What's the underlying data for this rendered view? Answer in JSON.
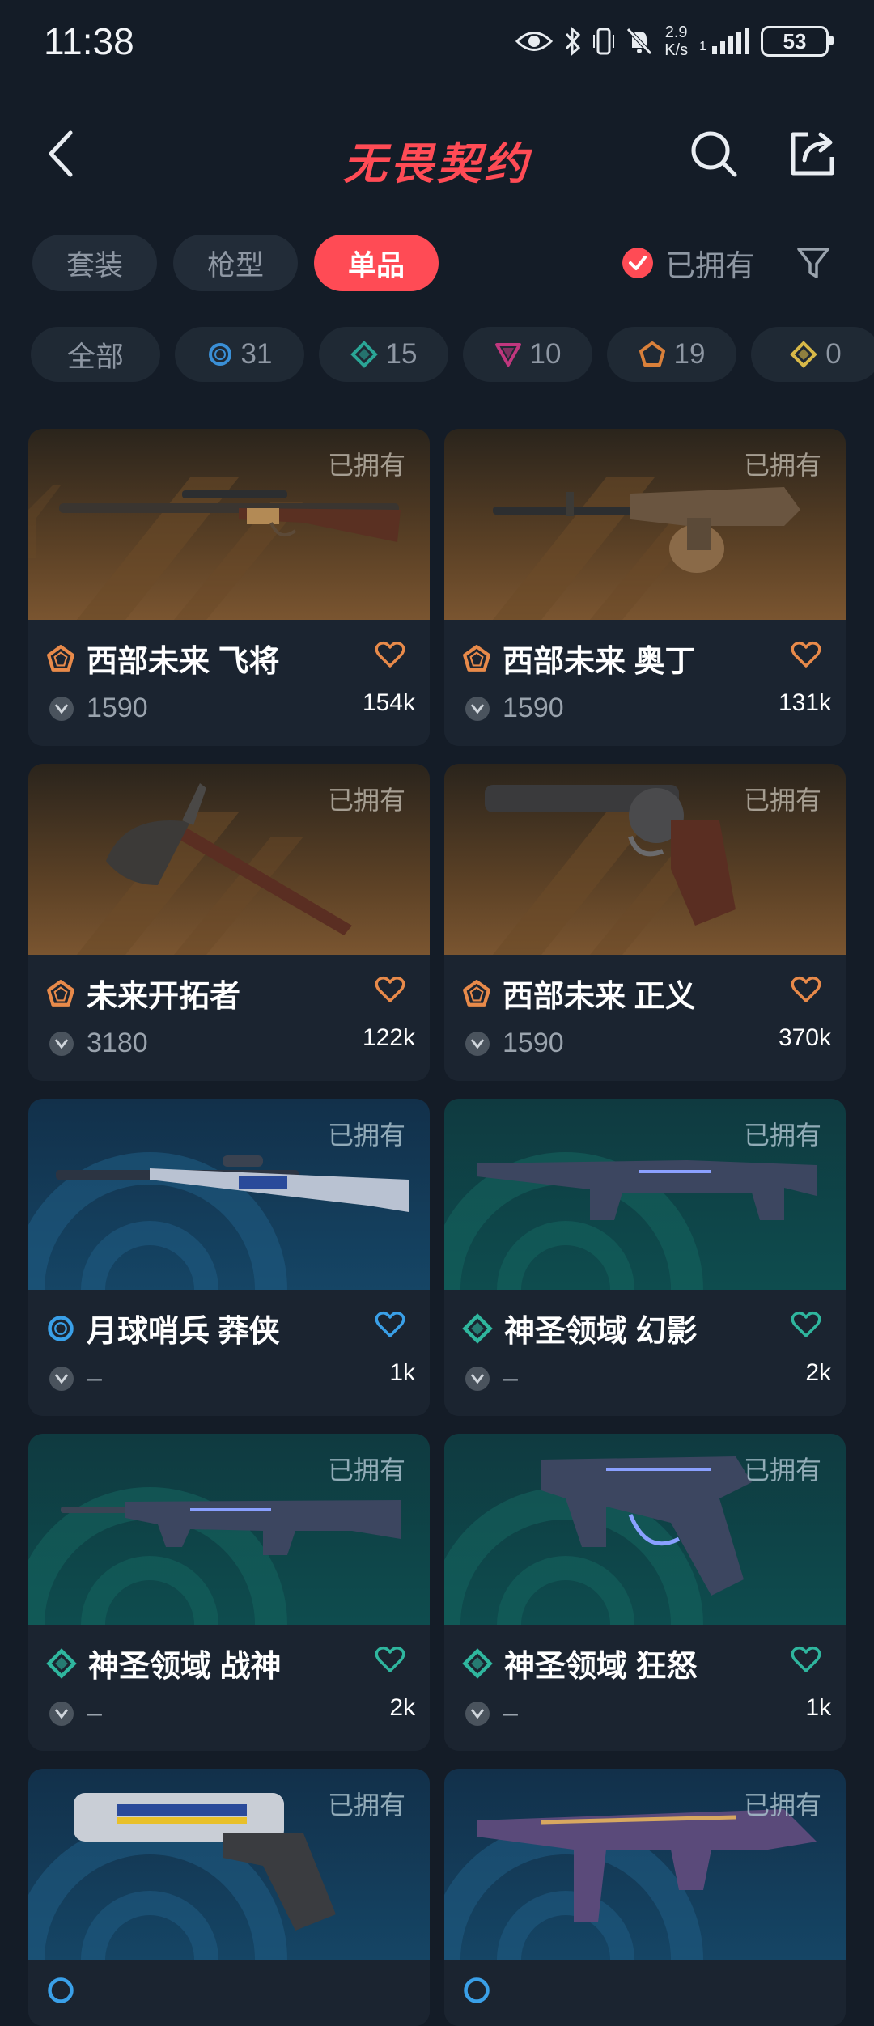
{
  "status_bar": {
    "time": "11:38",
    "net_speed_value": "2.9",
    "net_speed_unit": "K/s",
    "signal_label": "1",
    "battery": "53",
    "icons": [
      "eye-icon",
      "bluetooth-icon",
      "vibrate-icon",
      "mute-icon",
      "signal-icon",
      "battery-icon"
    ]
  },
  "header": {
    "logo": "无畏契约",
    "back_icon": "chevron-left-icon",
    "search_icon": "search-icon",
    "share_icon": "share-icon"
  },
  "tabs": [
    {
      "label": "套装",
      "active": false
    },
    {
      "label": "枪型",
      "active": false
    },
    {
      "label": "单品",
      "active": true
    }
  ],
  "owned_filter": {
    "label": "已拥有",
    "checked": true
  },
  "tiers": [
    {
      "label": "全部",
      "count": "",
      "color": ""
    },
    {
      "label": "",
      "count": "31",
      "color": "#3a8fd6",
      "shape": "circle"
    },
    {
      "label": "",
      "count": "15",
      "color": "#2aa596",
      "shape": "diamond"
    },
    {
      "label": "",
      "count": "10",
      "color": "#c0377e",
      "shape": "triangle"
    },
    {
      "label": "",
      "count": "19",
      "color": "#d9803a",
      "shape": "pentagon"
    },
    {
      "label": "",
      "count": "0",
      "color": "#d8b948",
      "shape": "diamond-small"
    }
  ],
  "cards": [
    {
      "name": "西部未来 飞将",
      "price": "1590",
      "likes": "154k",
      "owned": "已拥有",
      "tier": "premium",
      "tier_color": "#e88a4a"
    },
    {
      "name": "西部未来 奥丁",
      "price": "1590",
      "likes": "131k",
      "owned": "已拥有",
      "tier": "premium",
      "tier_color": "#e88a4a"
    },
    {
      "name": "未来开拓者",
      "price": "3180",
      "likes": "122k",
      "owned": "已拥有",
      "tier": "premium",
      "tier_color": "#e88a4a"
    },
    {
      "name": "西部未来 正义",
      "price": "1590",
      "likes": "370k",
      "owned": "已拥有",
      "tier": "premium",
      "tier_color": "#e88a4a"
    },
    {
      "name": "月球哨兵 莽侠",
      "price": "–",
      "likes": "1k",
      "owned": "已拥有",
      "tier": "luxe",
      "tier_color": "#3aa0e8"
    },
    {
      "name": "神圣领域 幻影",
      "price": "–",
      "likes": "2k",
      "owned": "已拥有",
      "tier": "select",
      "tier_color": "#2fb69e"
    },
    {
      "name": "神圣领域 战神",
      "price": "–",
      "likes": "2k",
      "owned": "已拥有",
      "tier": "select",
      "tier_color": "#2fb69e"
    },
    {
      "name": "神圣领域 狂怒",
      "price": "–",
      "likes": "1k",
      "owned": "已拥有",
      "tier": "select",
      "tier_color": "#2fb69e"
    },
    {
      "name": "",
      "price": "",
      "likes": "",
      "owned": "已拥有",
      "tier": "luxe",
      "tier_color": "#3aa0e8"
    },
    {
      "name": "",
      "price": "",
      "likes": "",
      "owned": "已拥有",
      "tier": "luxe",
      "tier_color": "#3aa0e8"
    }
  ]
}
